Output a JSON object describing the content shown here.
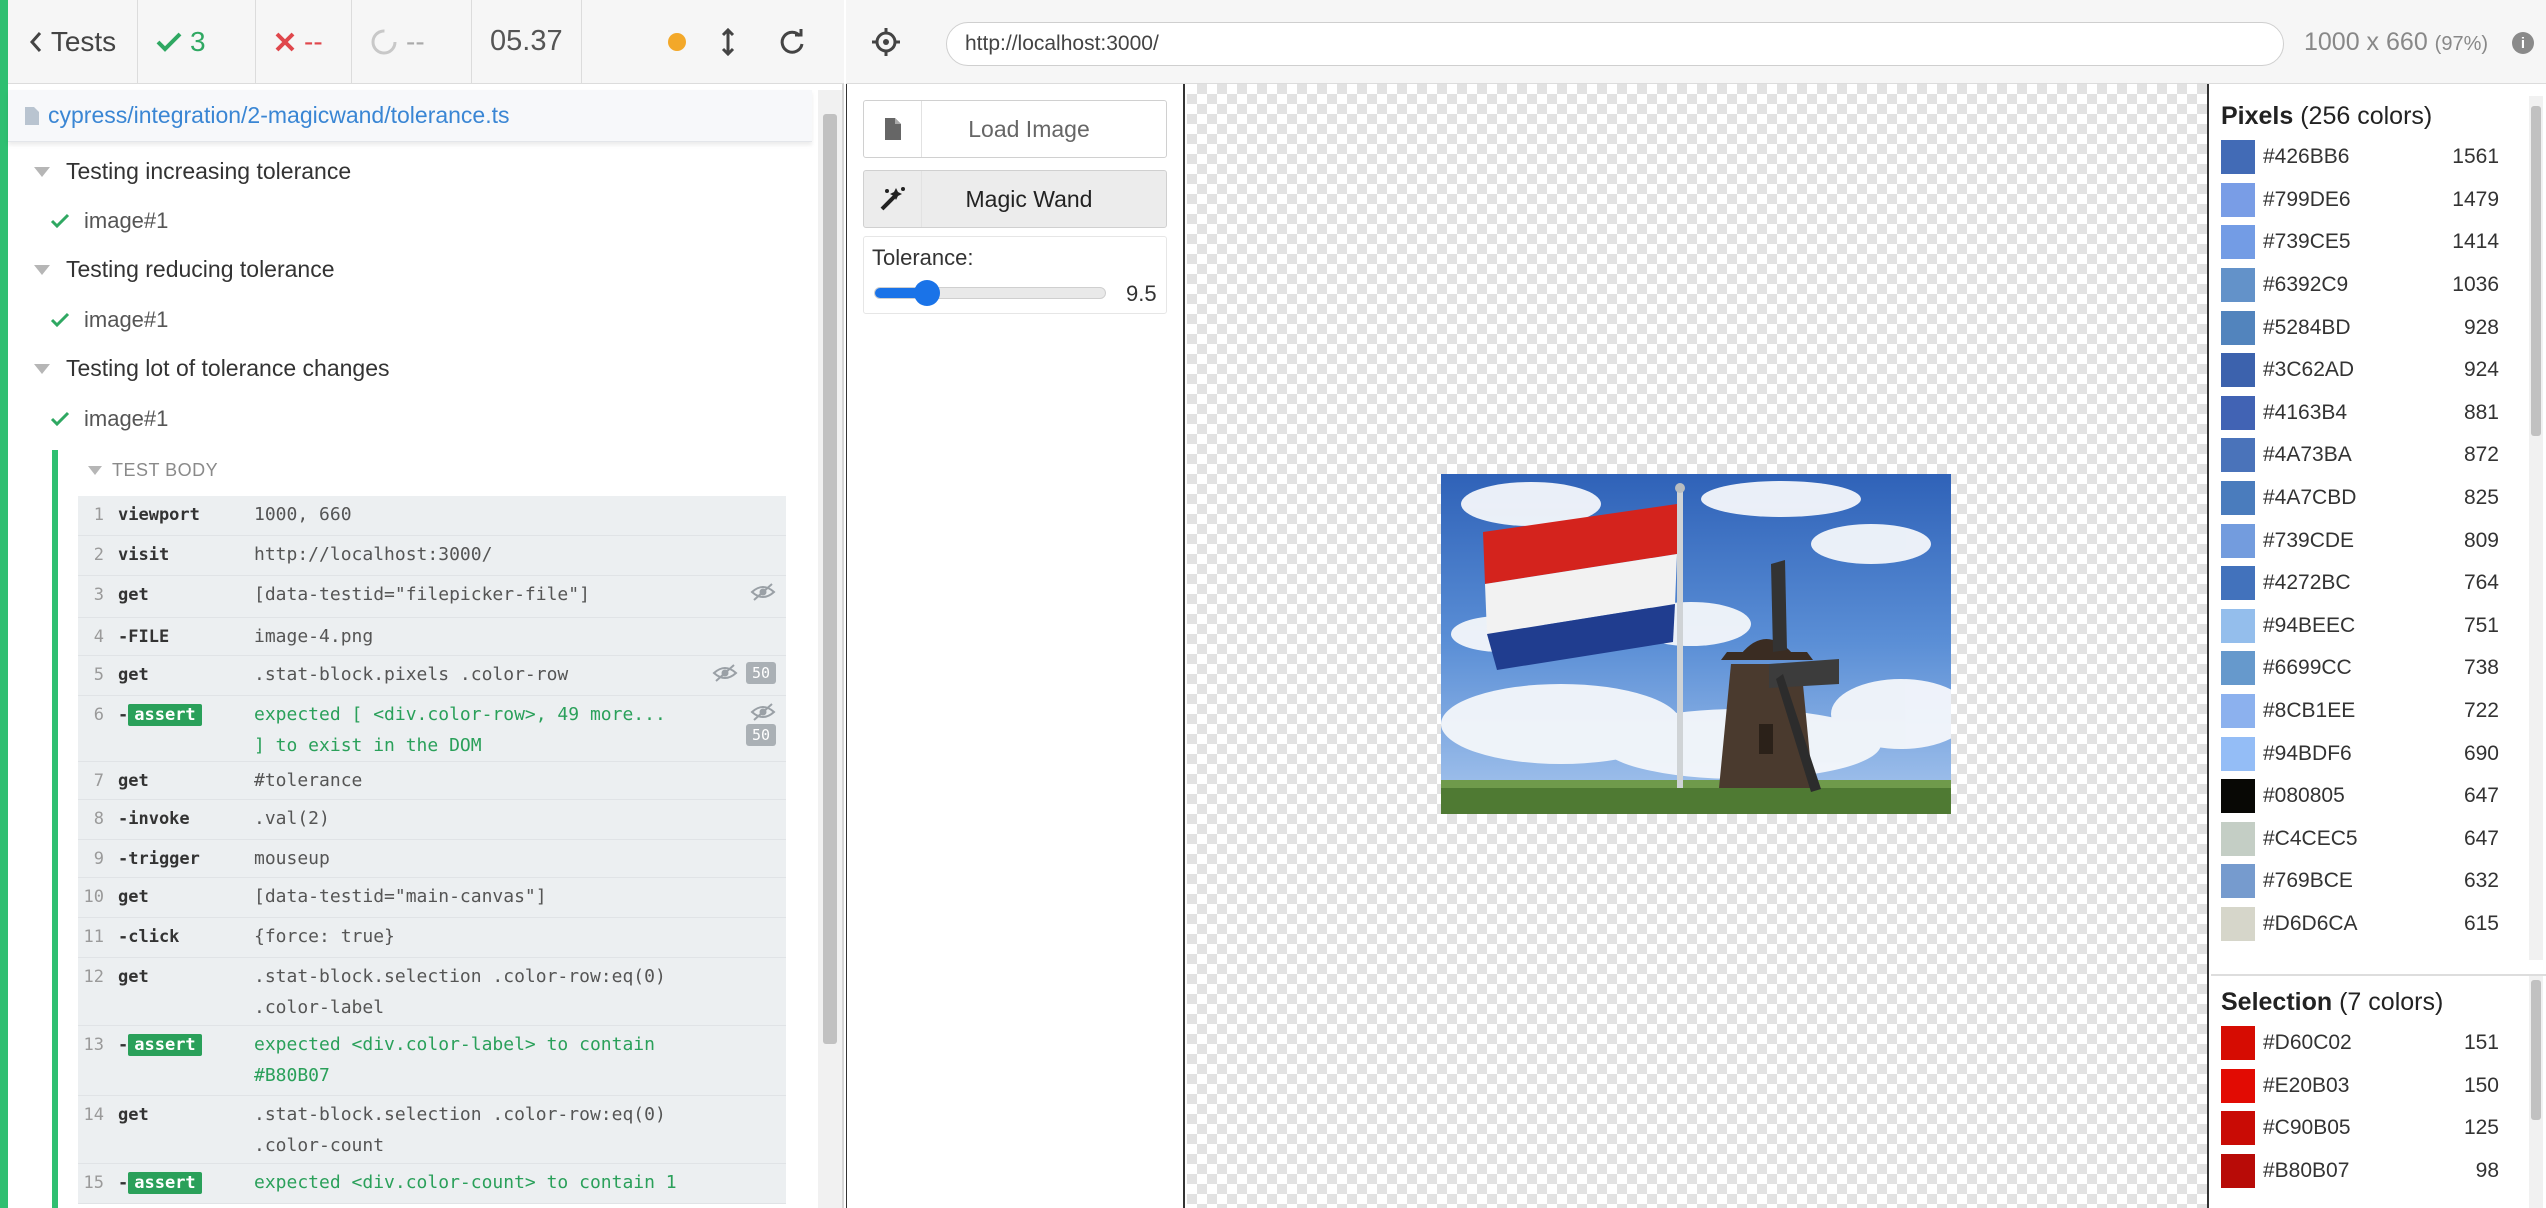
{
  "reporter": {
    "tests_label": "Tests",
    "passed": "3",
    "failed": "--",
    "pending": "--",
    "duration": "05.37",
    "spec_path": "cypress/integration/2-magicwand/tolerance.ts"
  },
  "suites": [
    {
      "title": "Testing increasing tolerance",
      "test": "image#1"
    },
    {
      "title": "Testing reducing tolerance",
      "test": "image#1"
    },
    {
      "title": "Testing lot of tolerance changes",
      "test": "image#1"
    }
  ],
  "test_body_label": "TEST BODY",
  "commands": [
    {
      "num": "1",
      "name": "viewport",
      "msg": "1000, 660"
    },
    {
      "num": "2",
      "name": "visit",
      "msg": "http://localhost:3000/"
    },
    {
      "num": "3",
      "name": "get",
      "msg": "[data-testid=\"filepicker-file\"]",
      "hidden_icon": true
    },
    {
      "num": "4",
      "name": "-FILE",
      "msg": "image-4.png"
    },
    {
      "num": "5",
      "name": "get",
      "msg": ".stat-block.pixels .color-row",
      "hidden_icon": true,
      "count": "50"
    },
    {
      "num": "6",
      "name": "assert",
      "msg": "expected [ <div.color-row>, 49 more... ] to exist in the DOM",
      "assert": true,
      "hidden_icon": true,
      "count": "50"
    },
    {
      "num": "7",
      "name": "get",
      "msg": "#tolerance"
    },
    {
      "num": "8",
      "name": "-invoke",
      "msg": ".val(2)"
    },
    {
      "num": "9",
      "name": "-trigger",
      "msg": "mouseup"
    },
    {
      "num": "10",
      "name": "get",
      "msg": "[data-testid=\"main-canvas\"]"
    },
    {
      "num": "11",
      "name": "-click",
      "msg": "{force: true}"
    },
    {
      "num": "12",
      "name": "get",
      "msg": ".stat-block.selection .color-row:eq(0) .color-label"
    },
    {
      "num": "13",
      "name": "assert",
      "msg": "expected <div.color-label> to contain #B80B07",
      "assert": true
    },
    {
      "num": "14",
      "name": "get",
      "msg": ".stat-block.selection .color-row:eq(0) .color-count"
    },
    {
      "num": "15",
      "name": "assert",
      "msg": "expected <div.color-count> to contain 1",
      "assert": true
    }
  ],
  "aut": {
    "url": "http://localhost:3000/",
    "viewport": "1000 x 660",
    "viewport_pct": "(97%)"
  },
  "toolbar": {
    "load_image": "Load Image",
    "magic_wand": "Magic Wand",
    "tolerance_label": "Tolerance:",
    "tolerance_value": "9.5",
    "tolerance_fraction": 0.225
  },
  "pixels": {
    "title": "Pixels",
    "subtitle": "(256 colors)",
    "rows": [
      {
        "label": "#426BB6",
        "count": "1561"
      },
      {
        "label": "#799DE6",
        "count": "1479"
      },
      {
        "label": "#739CE5",
        "count": "1414"
      },
      {
        "label": "#6392C9",
        "count": "1036"
      },
      {
        "label": "#5284BD",
        "count": "928"
      },
      {
        "label": "#3C62AD",
        "count": "924"
      },
      {
        "label": "#4163B4",
        "count": "881"
      },
      {
        "label": "#4A73BA",
        "count": "872"
      },
      {
        "label": "#4A7CBD",
        "count": "825"
      },
      {
        "label": "#739CDE",
        "count": "809"
      },
      {
        "label": "#4272BC",
        "count": "764"
      },
      {
        "label": "#94BEEC",
        "count": "751"
      },
      {
        "label": "#6699CC",
        "count": "738"
      },
      {
        "label": "#8CB1EE",
        "count": "722"
      },
      {
        "label": "#94BDF6",
        "count": "690"
      },
      {
        "label": "#080805",
        "count": "647"
      },
      {
        "label": "#C4CEC5",
        "count": "647"
      },
      {
        "label": "#769BCE",
        "count": "632"
      },
      {
        "label": "#D6D6CA",
        "count": "615"
      }
    ]
  },
  "selection": {
    "title": "Selection",
    "subtitle": "(7 colors)",
    "rows": [
      {
        "label": "#D60C02",
        "count": "151"
      },
      {
        "label": "#E20B03",
        "count": "150"
      },
      {
        "label": "#C90B05",
        "count": "125"
      },
      {
        "label": "#B80B07",
        "count": "98"
      }
    ]
  }
}
